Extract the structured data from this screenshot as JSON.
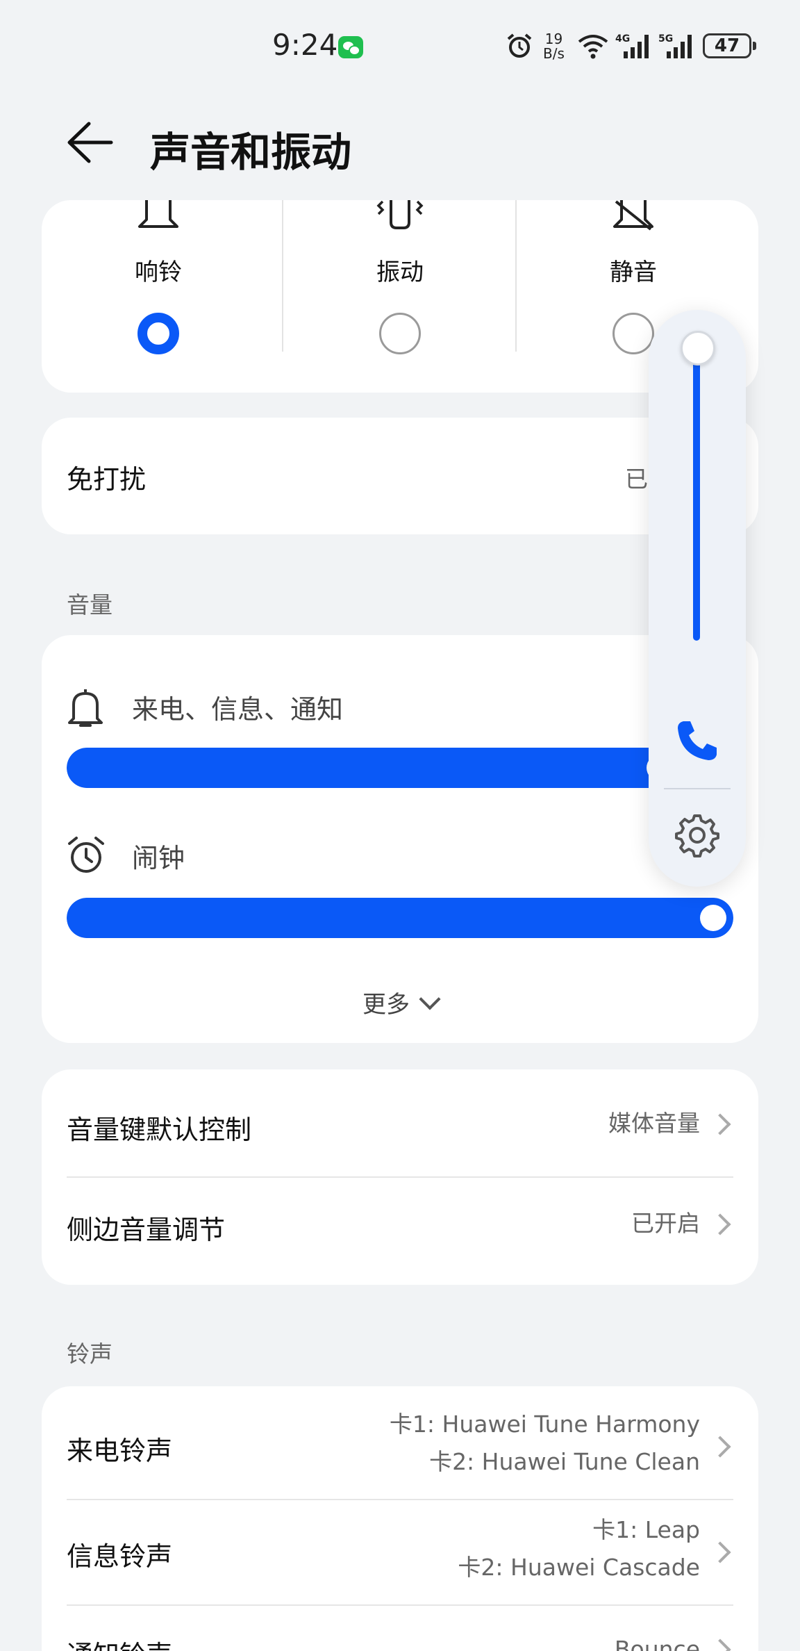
{
  "status_bar": {
    "time": "9:24",
    "net_speed_value": "19",
    "net_speed_unit": "B/s",
    "sig1_label": "4G",
    "sig2_label": "5G",
    "battery": "47"
  },
  "header": {
    "title": "声音和振动"
  },
  "modes": [
    {
      "label": "响铃",
      "icon": "bell-icon",
      "selected": true
    },
    {
      "label": "振动",
      "icon": "vibrate-icon",
      "selected": false
    },
    {
      "label": "静音",
      "icon": "bell-off-icon",
      "selected": false
    }
  ],
  "dnd": {
    "label": "免打扰",
    "value": "已"
  },
  "volume": {
    "section_title": "音量",
    "ringtone": {
      "label": "来电、信息、通知",
      "level": 0.92
    },
    "alarm": {
      "label": "闹钟",
      "level": 1.0
    },
    "more_label": "更多"
  },
  "volume_settings": [
    {
      "label": "音量键默认控制",
      "value": "媒体音量"
    },
    {
      "label": "侧边音量调节",
      "value": "已开启"
    }
  ],
  "ringtones": {
    "section_title": "铃声",
    "items": [
      {
        "label": "来电铃声",
        "value1": "卡1: Huawei Tune Harmony",
        "value2": "卡2: Huawei Tune Clean"
      },
      {
        "label": "信息铃声",
        "value1": "卡1: Leap",
        "value2": "卡2: Huawei Cascade"
      },
      {
        "label": "通知铃声",
        "value1": "Bounce",
        "value2": ""
      }
    ]
  },
  "floating_panel": {
    "level": 1.0
  },
  "colors": {
    "accent": "#0a59f7",
    "background": "#f1f3f5",
    "card": "#ffffff"
  }
}
